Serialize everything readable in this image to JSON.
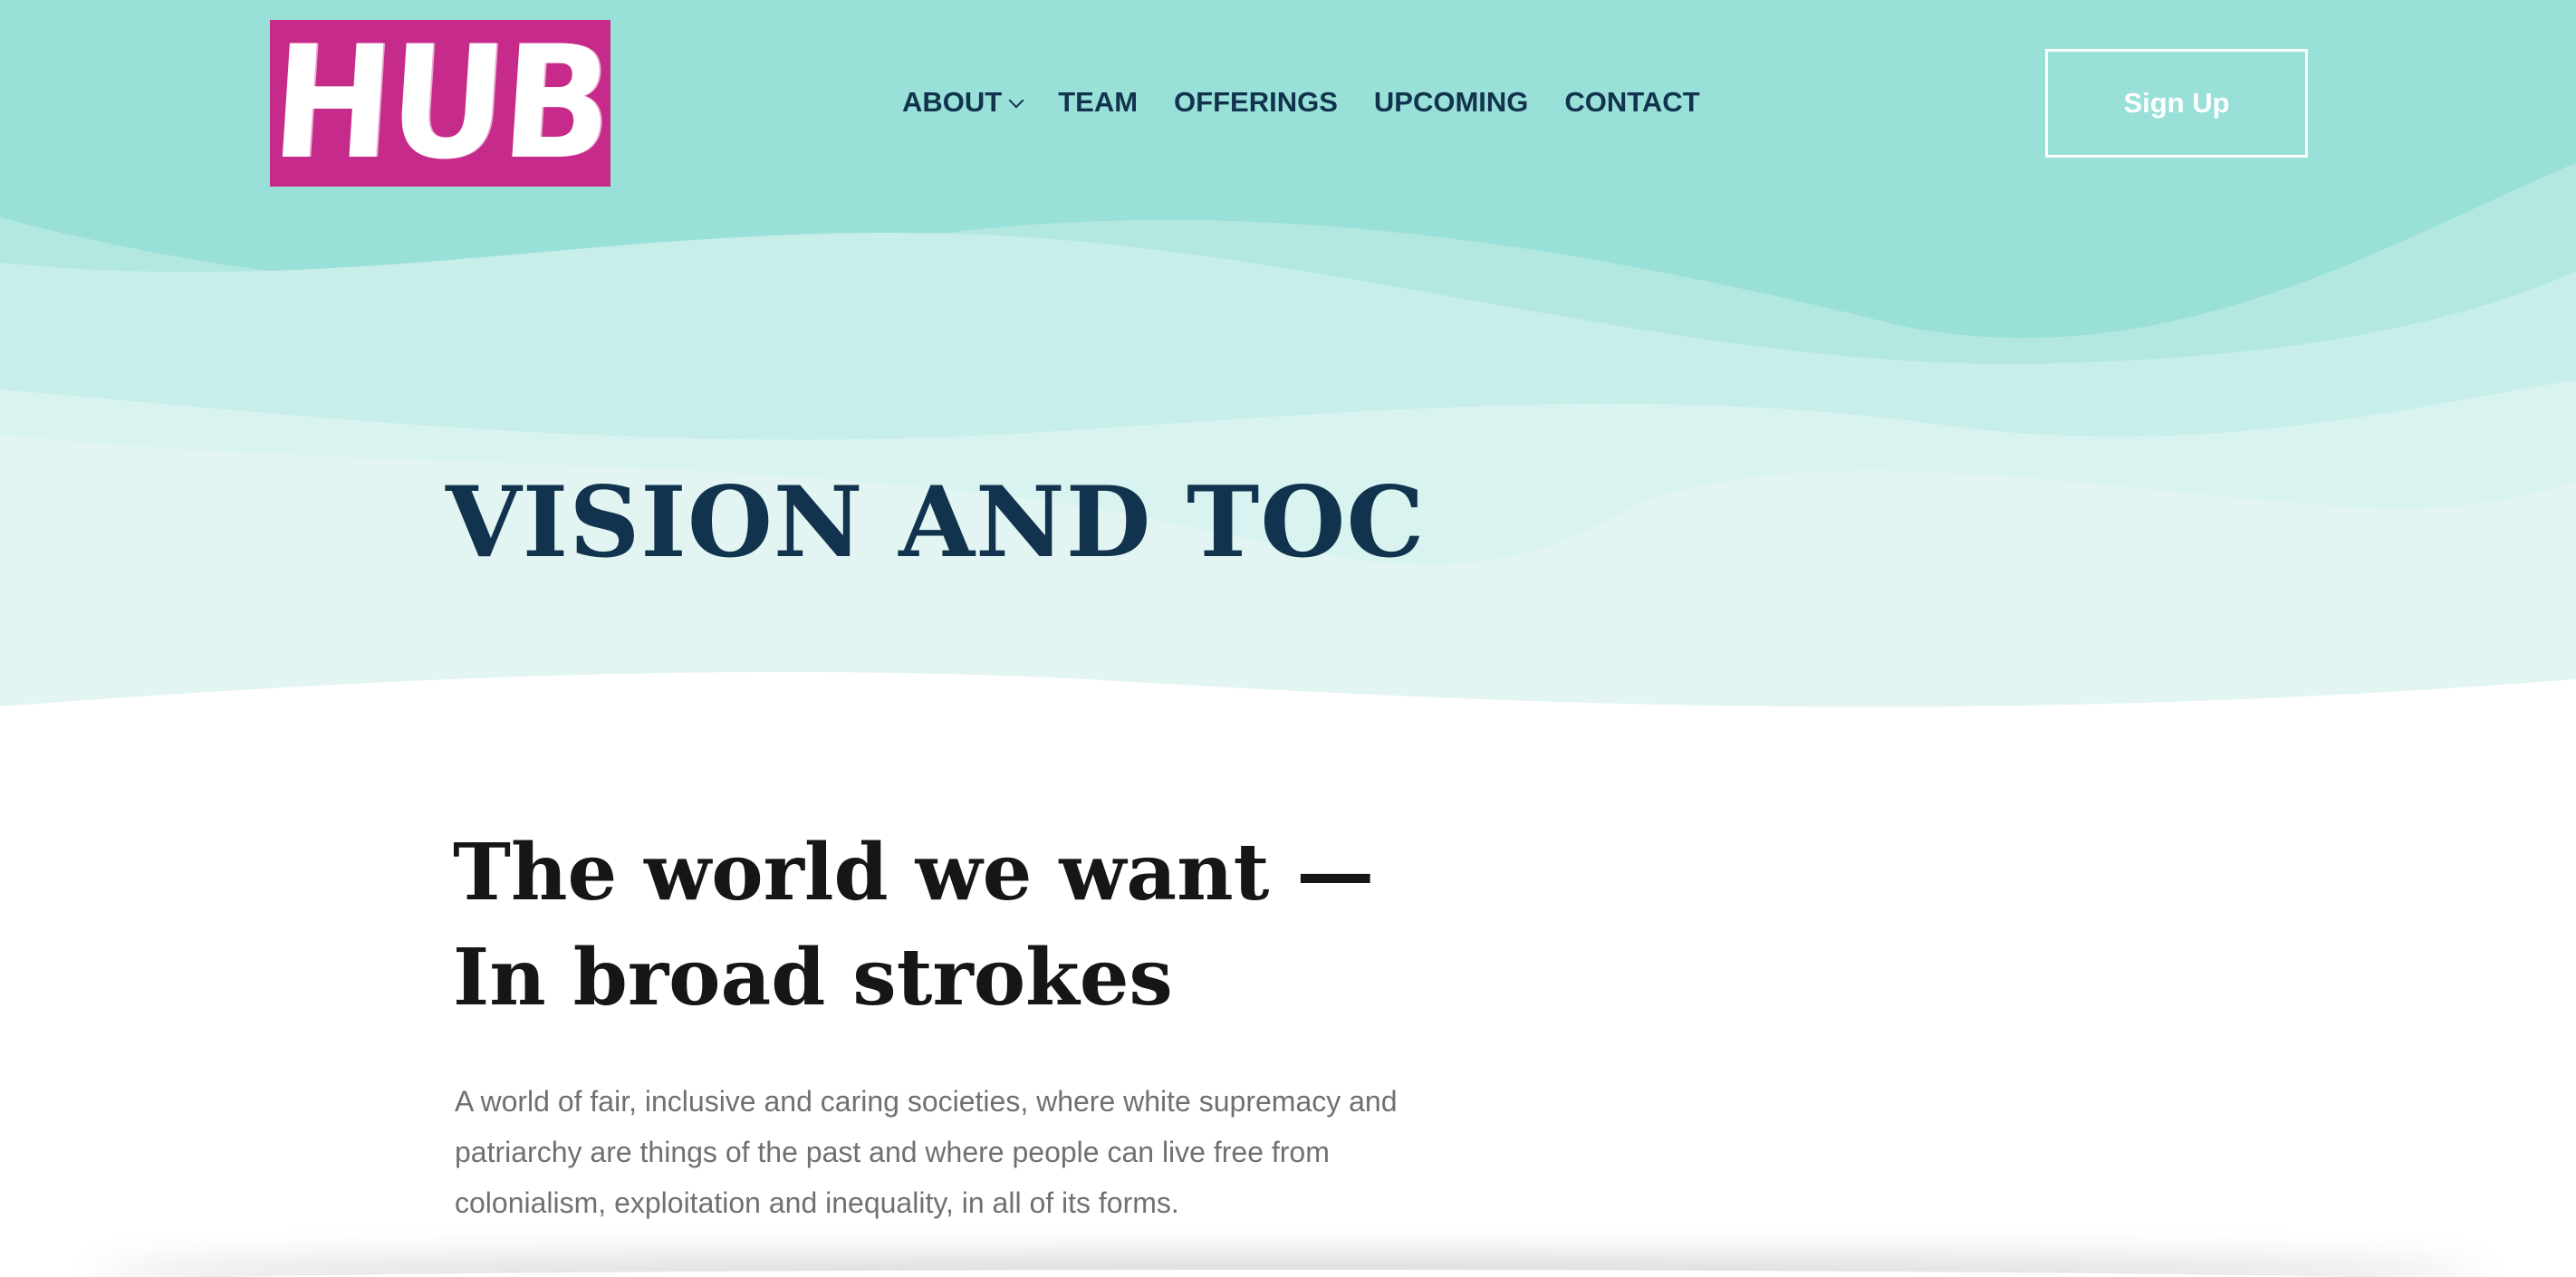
{
  "brand": {
    "logo_text": "HUB",
    "logo_color": "#c62a8a"
  },
  "nav": {
    "items": [
      {
        "label": "ABOUT",
        "has_dropdown": true
      },
      {
        "label": "TEAM"
      },
      {
        "label": "OFFERINGS"
      },
      {
        "label": "UPCOMING"
      },
      {
        "label": "CONTACT"
      }
    ]
  },
  "header": {
    "signup_label": "Sign Up"
  },
  "hero": {
    "title": "VISION AND TOC",
    "colors": {
      "deep": "#99e0d8",
      "mid": "#b3e8e1",
      "light": "#c8eeea",
      "lighter": "#d9f3f1",
      "palest": "#e2f5f3",
      "title": "#11334d"
    }
  },
  "content": {
    "heading_line1": "The world we want —",
    "heading_line2": "In broad strokes",
    "body": "A world of fair, inclusive and caring societies, where white supremacy and patriarchy are things of the past and where people can live free from colonialism, exploitation and inequality, in all of its forms."
  }
}
